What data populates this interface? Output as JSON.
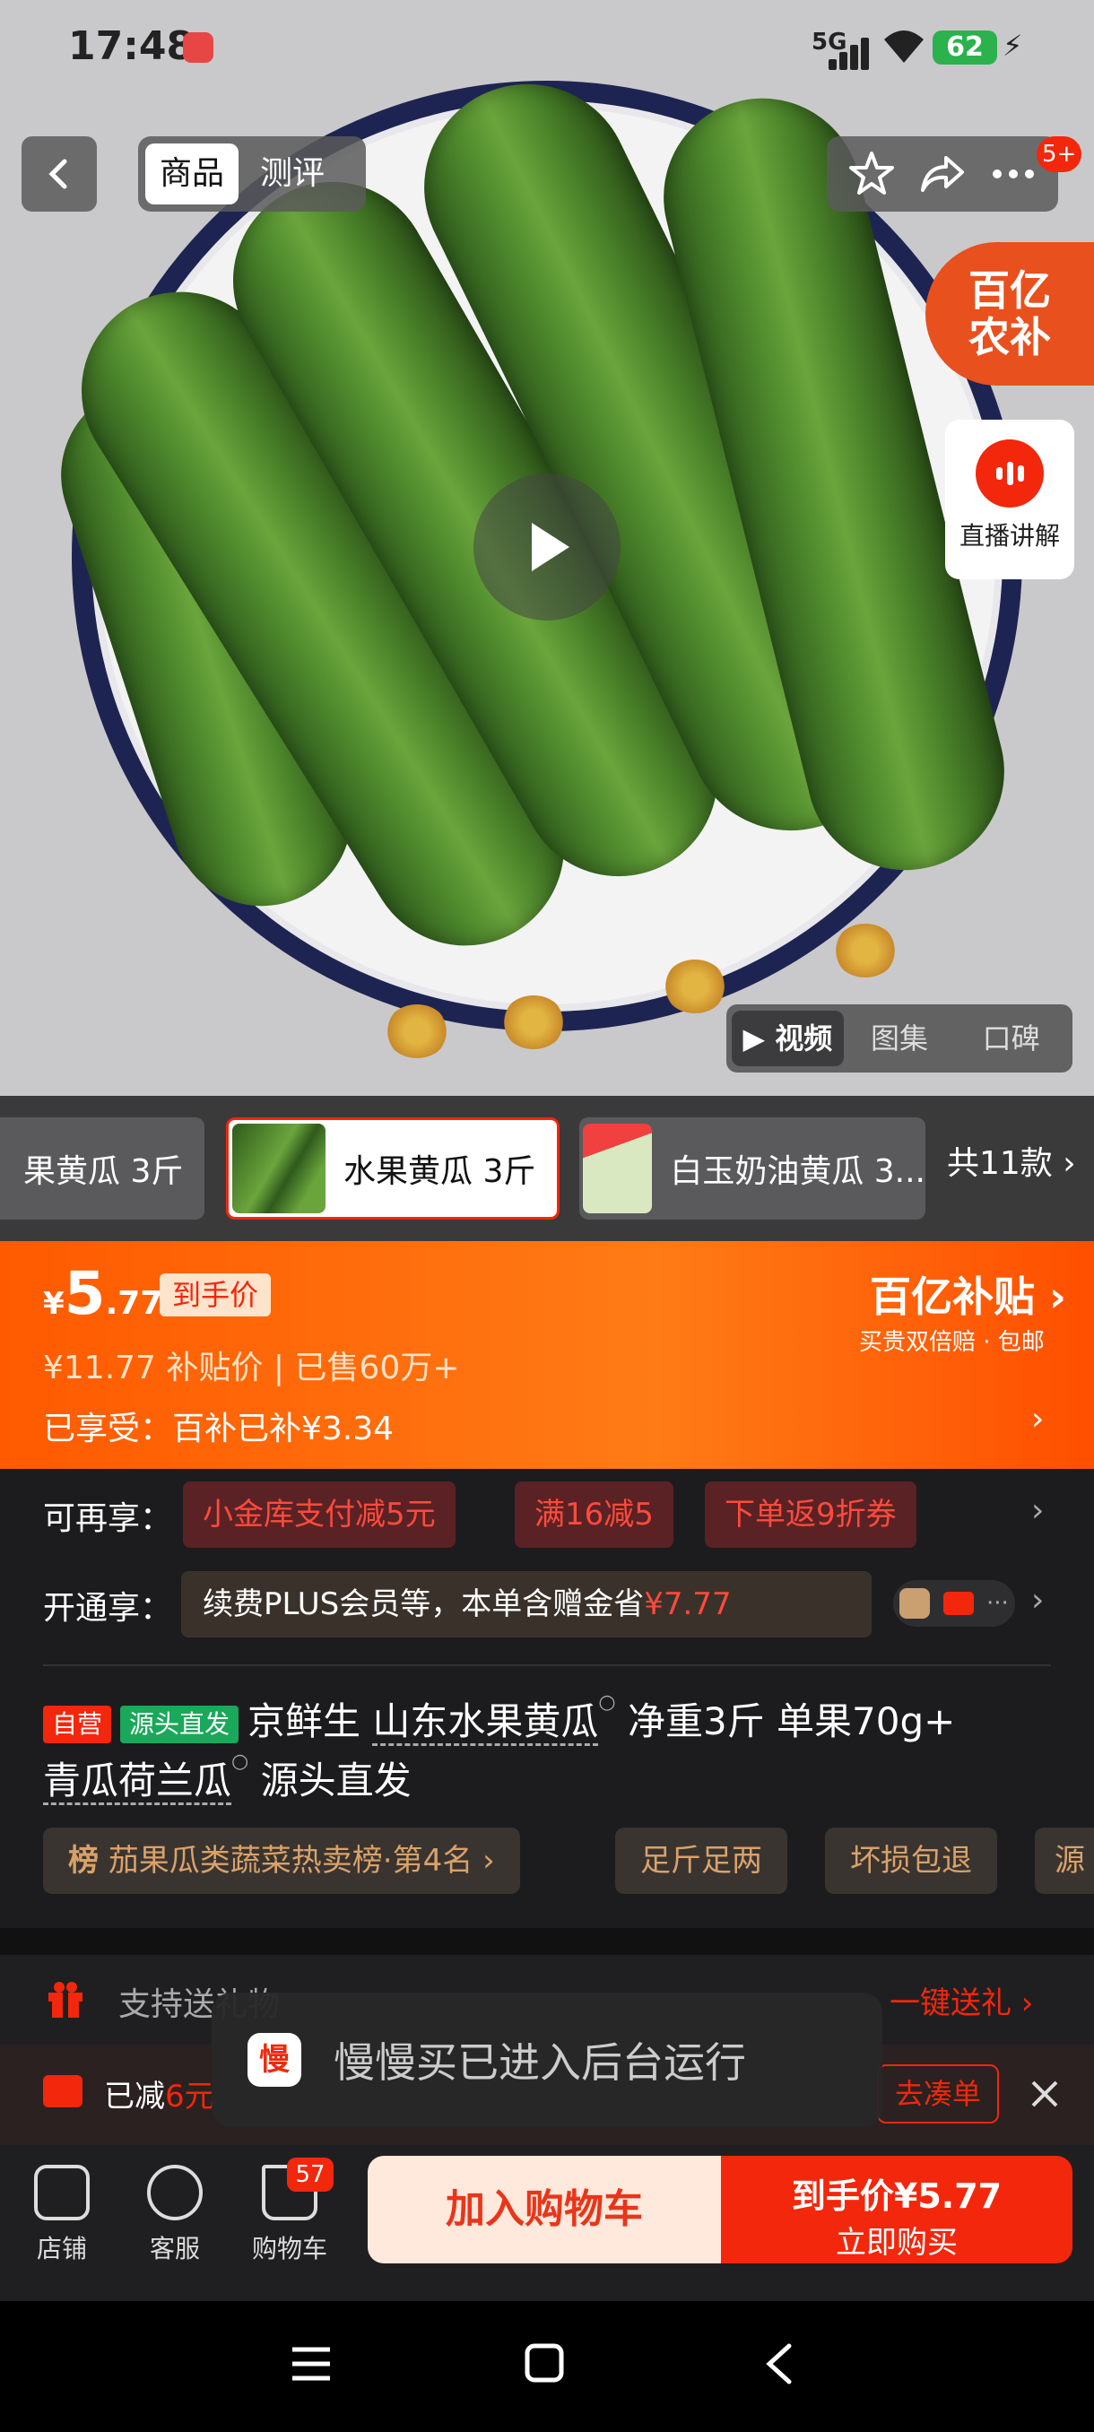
{
  "status_bar": {
    "time": "17:48",
    "network": "5G",
    "battery": "62"
  },
  "header": {
    "tabs": [
      "商品",
      "测评"
    ],
    "badge": "5+"
  },
  "hero": {
    "bybt_logo": "百亿农补",
    "live_label": "直播讲解",
    "media_tabs": [
      "视频",
      "图集",
      "口碑"
    ]
  },
  "variants": {
    "items": [
      "果黄瓜 3斤",
      "水果黄瓜 3斤",
      "白玉奶油黄瓜 3..."
    ],
    "more": "共11款"
  },
  "price": {
    "currency": "¥",
    "integer": "5",
    "decimal": ".77",
    "final_tag": "到手价",
    "sub": "¥11.77  补贴价 | 已售60万+",
    "enjoyed": "已享受：百补已补¥3.34",
    "brand": "百亿补贴",
    "brand_sub": "买贵双倍赔 · 包邮"
  },
  "promos": {
    "again_label": "可再享：",
    "coupons": [
      "小金库支付减5元",
      "满16减5",
      "下单返9折券"
    ],
    "plus_label": "开通享：",
    "plus_text": "续费PLUS会员等，本单含赠金省",
    "plus_amount": "¥7.77"
  },
  "title": {
    "self_tag": "自营",
    "src_tag": "源头直发",
    "line1_a": "京鲜生",
    "line1_b": "山东水果黄瓜",
    "line1_c": "净重3斤 单果70g+",
    "line2_a": "青瓜荷兰瓜",
    "line2_b": "源头直发"
  },
  "chips": [
    {
      "icon": "榜",
      "text": "茄果瓜类蔬菜热卖榜·第4名"
    },
    {
      "text": "足斤足两"
    },
    {
      "text": "坏损包退"
    },
    {
      "text": "源"
    }
  ],
  "gift": {
    "label": "支持送礼物",
    "action": "一键送礼"
  },
  "reduce": {
    "label": "已减",
    "amount": "6元",
    "action": "去凑单"
  },
  "toast": {
    "icon": "慢",
    "text": "慢慢买已进入后台运行"
  },
  "bottom": {
    "shop": "店铺",
    "service": "客服",
    "cart": "购物车",
    "cart_count": "57",
    "add_to_cart": "加入购物车",
    "buy_price": "到手价¥5.77",
    "buy_now": "立即购买"
  }
}
